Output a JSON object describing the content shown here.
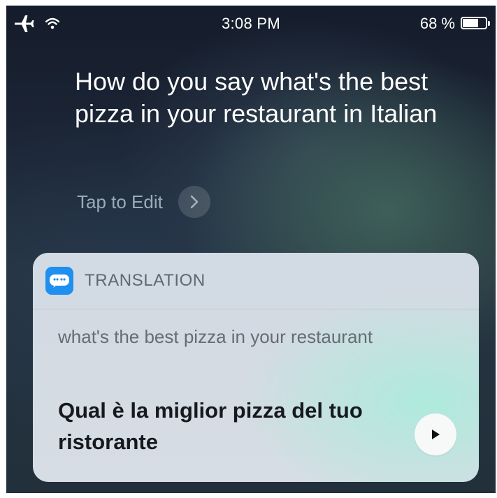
{
  "status_bar": {
    "time": "3:08 PM",
    "battery_percent_text": "68 %",
    "battery_level": 0.68,
    "icons": [
      "airplane-icon",
      "wifi-icon",
      "battery-icon"
    ]
  },
  "siri": {
    "query": "How do you say what's the best pizza in your restaurant in Italian",
    "tap_to_edit": "Tap to Edit",
    "tap_to_edit_icon": "chevron-right-icon"
  },
  "translation_card": {
    "app_icon": "quote-bubble-icon",
    "app_icon_color": "#1f8ff0",
    "title": "TRANSLATION",
    "source_text": "what's the best pizza in your restaurant",
    "translated_text": "Qual è la miglior pizza del tuo ristorante",
    "play_icon": "play-icon"
  }
}
